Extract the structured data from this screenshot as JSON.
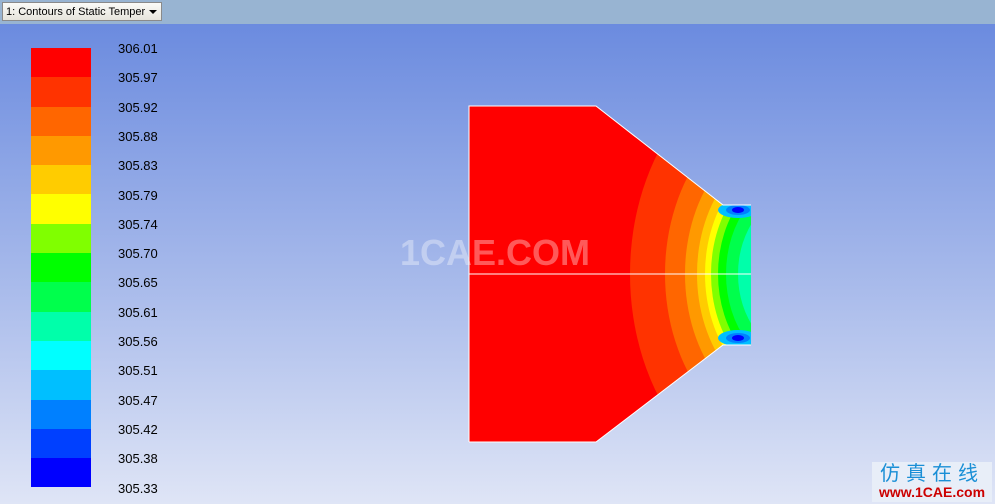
{
  "dropdown": {
    "selected": "1: Contours of Static Temper",
    "icon": "chevron-down-icon"
  },
  "legend": {
    "labels": [
      "306.01",
      "305.97",
      "305.92",
      "305.88",
      "305.83",
      "305.79",
      "305.74",
      "305.70",
      "305.65",
      "305.61",
      "305.56",
      "305.51",
      "305.47",
      "305.42",
      "305.38",
      "305.33"
    ],
    "colors": [
      "#ff0000",
      "#ff3300",
      "#ff6600",
      "#ff9900",
      "#ffcc00",
      "#ffff00",
      "#80ff00",
      "#00ff00",
      "#00ff4c",
      "#00ffaa",
      "#00ffff",
      "#00bfff",
      "#0080ff",
      "#0040ff",
      "#0000ff"
    ]
  },
  "watermark": "1CAE.COM",
  "logo": {
    "cn": "仿真在线",
    "en": "www.1CAE.com"
  }
}
